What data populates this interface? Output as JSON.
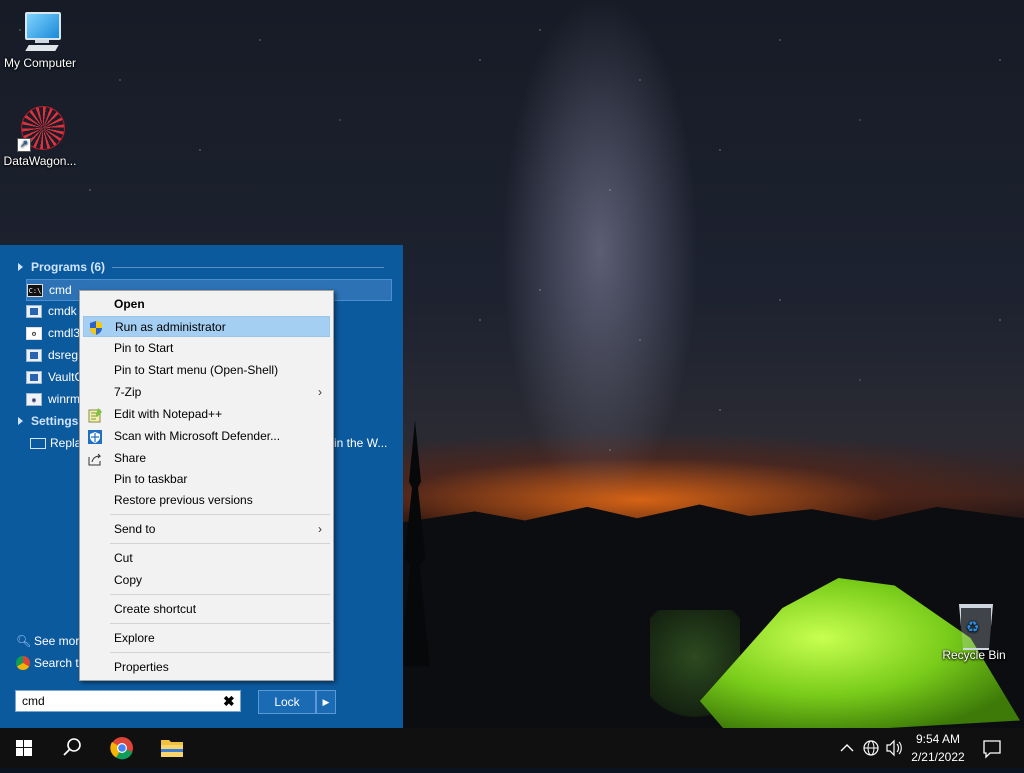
{
  "desktop": {
    "icons": [
      {
        "label": "My Computer",
        "icon": "computer-icon"
      },
      {
        "label": "DataWagon...",
        "icon": "datawagon-shortcut-icon"
      },
      {
        "label": "Recycle Bin",
        "icon": "recycle-bin-icon"
      }
    ]
  },
  "start_menu": {
    "programs_header": "Programs (6)",
    "programs": [
      {
        "label": "cmd",
        "icon": "cmd-icon"
      },
      {
        "label": "cmdk",
        "icon": "window-icon"
      },
      {
        "label": "cmdl3",
        "icon": "cmdl-icon"
      },
      {
        "label": "dsreg",
        "icon": "window-icon"
      },
      {
        "label": "VaultC",
        "icon": "window-icon"
      },
      {
        "label": "winrm",
        "icon": "winrm-icon"
      }
    ],
    "settings_header": "Settings",
    "settings_item": {
      "label_left": "Repla",
      "label_right": "in the W..."
    },
    "see_more": "See more",
    "search_the": "Search th",
    "search_value": "cmd",
    "lock_label": "Lock"
  },
  "context_menu": {
    "items": [
      {
        "label": "Open",
        "bold": true
      },
      {
        "label": "Run as administrator",
        "icon": "uac-shield-icon"
      },
      {
        "label": "Pin to Start"
      },
      {
        "label": "Pin to Start menu (Open-Shell)"
      },
      {
        "label": "7-Zip",
        "submenu": true
      },
      {
        "label": "Edit with Notepad++",
        "icon": "notepad-plus-icon"
      },
      {
        "label": "Scan with Microsoft Defender...",
        "icon": "defender-icon"
      },
      {
        "label": "Share",
        "icon": "share-icon"
      },
      {
        "label": "Pin to taskbar"
      },
      {
        "label": "Restore previous versions"
      },
      {
        "label": "Send to",
        "submenu": true
      },
      {
        "label": "Cut"
      },
      {
        "label": "Copy"
      },
      {
        "label": "Create shortcut"
      },
      {
        "label": "Explore"
      },
      {
        "label": "Properties"
      }
    ],
    "hover_item": "Run as administrator"
  },
  "taskbar": {
    "clock_time": "9:54 AM",
    "clock_date": "2/21/2022"
  },
  "colors": {
    "start_menu_bg": "#0c5a9e",
    "hover_bg": "#a4cff2",
    "tent_green": "#79cc1a"
  }
}
